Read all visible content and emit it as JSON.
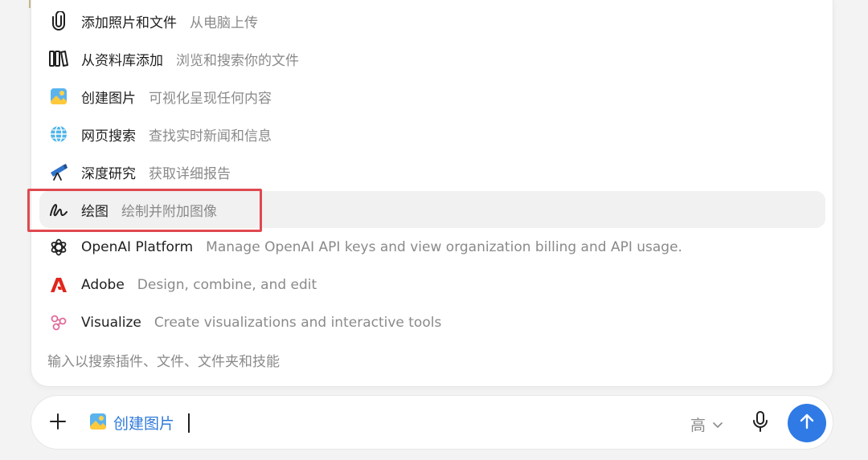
{
  "menu": {
    "items": [
      {
        "id": "upload",
        "icon": "paperclip-icon",
        "label": "添加照片和文件",
        "desc": "从电脑上传"
      },
      {
        "id": "library",
        "icon": "library-icon",
        "label": "从资料库添加",
        "desc": "浏览和搜索你的文件"
      },
      {
        "id": "create-image",
        "icon": "image-icon",
        "label": "创建图片",
        "desc": "可视化呈现任何内容"
      },
      {
        "id": "web-search",
        "icon": "globe-icon",
        "label": "网页搜索",
        "desc": "查找实时新闻和信息"
      },
      {
        "id": "deep-research",
        "icon": "telescope-icon",
        "label": "深度研究",
        "desc": "获取详细报告"
      },
      {
        "id": "draw",
        "icon": "squiggle-icon",
        "label": "绘图",
        "desc": "绘制并附加图像"
      },
      {
        "id": "openai-platform",
        "icon": "openai-logo-icon",
        "label": "OpenAI Platform",
        "desc": "Manage OpenAI API keys and view organization billing and API usage."
      },
      {
        "id": "adobe",
        "icon": "adobe-logo-icon",
        "label": "Adobe",
        "desc": "Design, combine, and edit"
      },
      {
        "id": "visualize",
        "icon": "visualize-icon",
        "label": "Visualize",
        "desc": "Create visualizations and interactive tools"
      }
    ],
    "footer_hint": "输入以搜索插件、文件、文件夹和技能"
  },
  "composer": {
    "selected_tool": "创建图片",
    "quality_label": "高"
  },
  "colors": {
    "accent_blue": "#2f7ae5",
    "highlight_red": "#e0484f",
    "adobe_red": "#e1251b"
  }
}
